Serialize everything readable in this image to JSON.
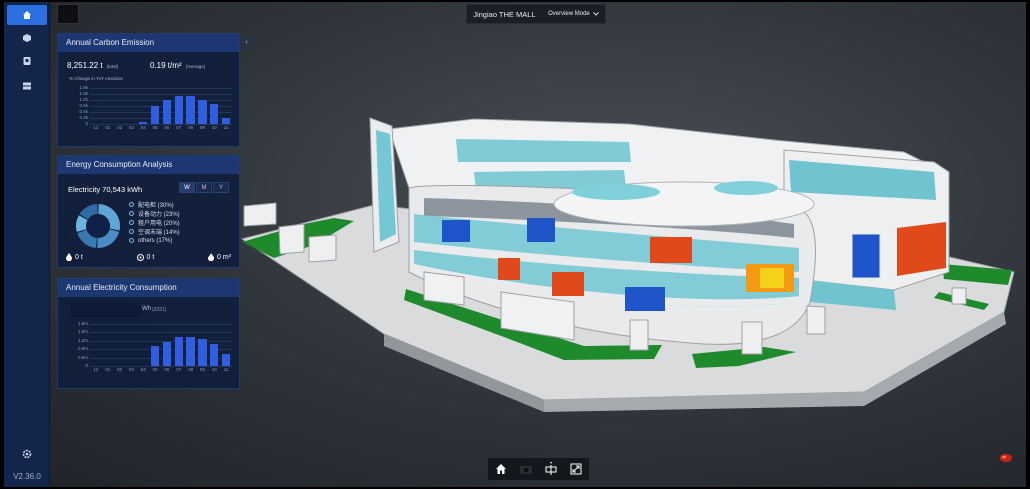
{
  "app": {
    "version": "V2.36.0"
  },
  "topbar": {
    "title": "Jingiao THE MALL",
    "mode_label": "Overview Mode"
  },
  "carbon_panel": {
    "title": "Annual Carbon Emission",
    "total_value": "8,251.22 t",
    "total_suffix": "(total)",
    "avg_value": "0.19 t/m²",
    "avg_suffix": "(Average)",
    "change_label": "% Change in YoY emission",
    "chart_data": {
      "type": "bar",
      "categories": [
        "12",
        "01",
        "02",
        "03",
        "04",
        "05",
        "06",
        "07",
        "08",
        "09",
        "10",
        "11"
      ],
      "values": [
        0,
        0,
        0,
        0,
        0.1,
        0.9,
        1.2,
        1.4,
        1.4,
        1.2,
        1.0,
        0.3
      ],
      "y_ticks": [
        "1.8k",
        "1.5k",
        "1.2k",
        "0.9k",
        "0.6k",
        "0.3k",
        "0"
      ],
      "ylim": [
        0,
        1.8
      ],
      "color": "#2f5fe0"
    }
  },
  "energy_panel": {
    "title": "Energy Consumption Analysis",
    "headline": "Electricity 70,543 kWh",
    "period_buttons": [
      "W",
      "M",
      "Y"
    ],
    "active_period": "W",
    "chart_data": {
      "type": "pie",
      "labels": [
        "配电柜",
        "设备动力",
        "租户用电",
        "空调末端",
        "others"
      ],
      "values": [
        30,
        23,
        20,
        14,
        17
      ]
    },
    "legend": [
      "配电柜 (30%)",
      "设备动力 (23%)",
      "租户用电 (20%)",
      "空调末端 (14%)",
      "others (17%)"
    ],
    "footer": [
      "0 t",
      "0 t",
      "0 m³"
    ]
  },
  "electricity_panel": {
    "title": "Annual Electricity Consumption",
    "value_suffix": "Wh",
    "year": "(2021)",
    "chart_data": {
      "type": "bar",
      "categories": [
        "12",
        "01",
        "02",
        "03",
        "04",
        "05",
        "06",
        "07",
        "08",
        "09",
        "10",
        "11"
      ],
      "values": [
        0,
        0,
        0,
        0,
        0,
        0.85,
        1.05,
        1.25,
        1.25,
        1.15,
        0.95,
        0.5
      ],
      "y_ticks": [
        "1.8m",
        "1.5m",
        "1.2m",
        "0.9m",
        "0.5m",
        "0"
      ],
      "ylim": [
        0,
        1.8
      ],
      "color": "#2f5fe0"
    }
  }
}
